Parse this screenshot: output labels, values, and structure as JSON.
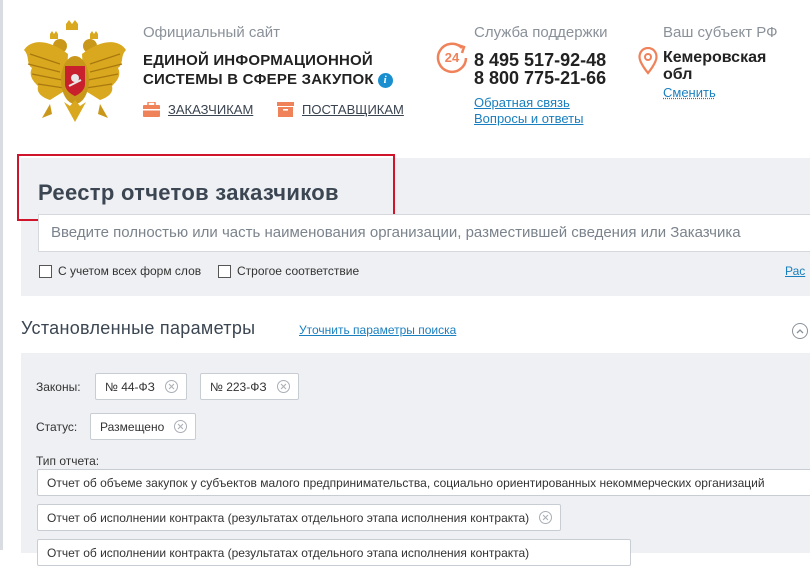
{
  "header": {
    "site_label": "Официальный сайт",
    "site_title_line1": "ЕДИНОЙ ИНФОРМАЦИОННОЙ",
    "site_title_line2": "СИСТЕМЫ В СФЕРЕ ЗАКУПОК",
    "info_icon": "i",
    "nav": {
      "customers": "ЗАКАЗЧИКАМ",
      "suppliers": "ПОСТАВЩИКАМ"
    },
    "support": {
      "label": "Служба поддержки",
      "icon_text": "24",
      "phone1": "8 495 517-92-48",
      "phone2": "8 800 775-21-66",
      "feedback": "Обратная связь",
      "faq": "Вопросы и ответы"
    },
    "region": {
      "label": "Ваш субъект РФ",
      "name_line1": "Кемеровская",
      "name_line2": "обл",
      "change": "Сменить"
    }
  },
  "search": {
    "title": "Реестр отчетов заказчиков",
    "placeholder": "Введите полностью или часть наименования организации, разместившей сведения или Заказчика",
    "option_all_forms": "С учетом всех форм слов",
    "option_strict": "Строгое соответствие",
    "extended_link": "Рас"
  },
  "params": {
    "title": "Установленные параметры",
    "refine_link": "Уточнить параметры поиска",
    "laws_label": "Законы:",
    "laws": [
      "№ 44-ФЗ",
      "№ 223-ФЗ"
    ],
    "status_label": "Статус:",
    "status": "Размещено",
    "report_type_label": "Тип отчета:",
    "report_types": [
      "Отчет об объеме закупок у субъектов малого предпринимательства, социально ориентированных некоммерческих организаций",
      "Отчет об исполнении контракта (результатах отдельного этапа исполнения контракта)",
      "Отчет об исполнении контракта (результатах отдельного этапа исполнения контракта)"
    ]
  },
  "colors": {
    "accent_orange": "#f0825a",
    "link_blue": "#1a7fbf",
    "highlight_red": "#d0142c",
    "panel_bg": "#eef0f3"
  }
}
